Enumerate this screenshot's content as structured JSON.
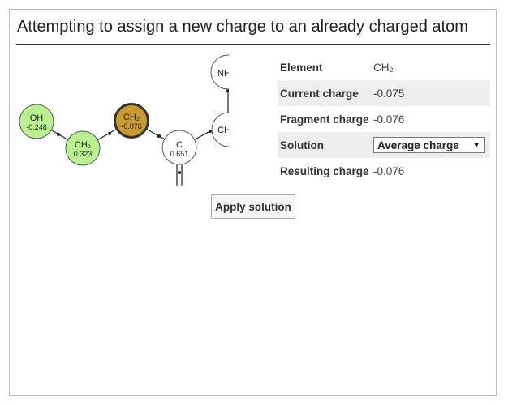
{
  "dialog": {
    "title": "Attempting to assign a new charge to an already charged atom"
  },
  "molecule": {
    "atoms": [
      {
        "id": "oh",
        "label": "OH",
        "charge": "-0.248",
        "state": "assigned",
        "color": "#b8f28e"
      },
      {
        "id": "ch2-left",
        "label": "CH₂",
        "charge": "0.323",
        "state": "assigned",
        "color": "#b8f28e"
      },
      {
        "id": "ch2-selected",
        "label": "CH₂",
        "charge": "-0.076",
        "state": "selected",
        "color": "#c99a2e"
      },
      {
        "id": "c",
        "label": "C",
        "charge": "0.651",
        "state": "unassigned",
        "color": "#ffffff"
      },
      {
        "id": "nh-partial",
        "label": "NH",
        "charge": "",
        "state": "unassigned",
        "color": "#ffffff"
      },
      {
        "id": "ch-partial",
        "label": "CH",
        "charge": "",
        "state": "unassigned",
        "color": "#ffffff"
      }
    ]
  },
  "properties": {
    "element_label": "Element",
    "element_value": "CH₂",
    "current_charge_label": "Current charge",
    "current_charge_value": "-0.075",
    "fragment_charge_label": "Fragment charge",
    "fragment_charge_value": "-0.076",
    "solution_label": "Solution",
    "solution_selected": "Average charge",
    "resulting_charge_label": "Resulting charge",
    "resulting_charge_value": "-0.076"
  },
  "actions": {
    "apply_label": "Apply solution"
  }
}
